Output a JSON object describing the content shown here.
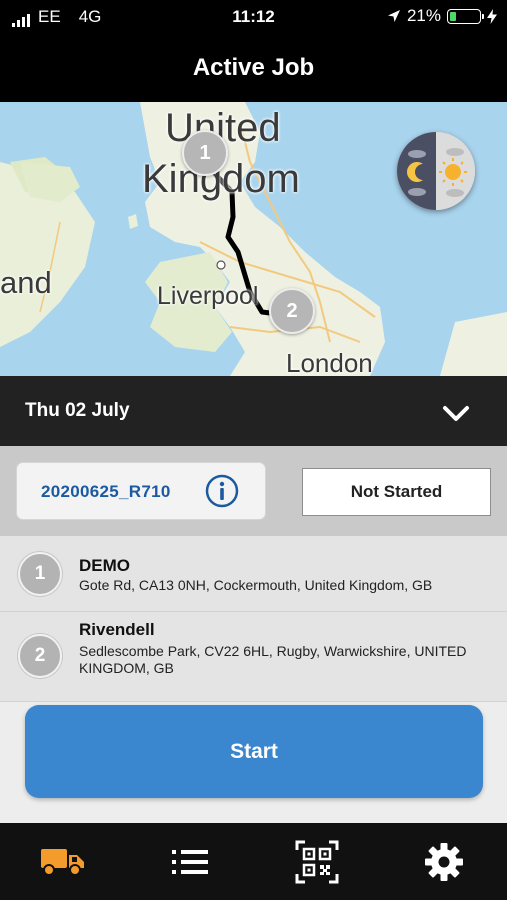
{
  "status_bar": {
    "carrier": "EE",
    "network": "4G",
    "time": "11:12",
    "battery_percent": "21%",
    "battery_level": 0.21
  },
  "header": {
    "title": "Active Job"
  },
  "map": {
    "labels": {
      "united": "United",
      "kingdom": "Kingdom",
      "and": "and",
      "liverpool": "Liverpool",
      "london": "London"
    },
    "pins": [
      "1",
      "2"
    ]
  },
  "date_bar": {
    "date": "Thu 02 July"
  },
  "job": {
    "id": "20200625_R710",
    "status": "Not Started"
  },
  "stops": [
    {
      "number": "1",
      "name": "DEMO",
      "address": "Gote Rd, CA13 0NH, Cockermouth, United Kingdom, GB"
    },
    {
      "number": "2",
      "name": "Rivendell",
      "address": "Sedlescombe Park, CV22 6HL, Rugby, Warwickshire, UNITED KINGDOM, GB"
    }
  ],
  "actions": {
    "start_label": "Start"
  },
  "colors": {
    "accent_blue": "#3a86cf",
    "job_id_text": "#1b5aa0",
    "tab_active": "#f39c2b",
    "battery_green": "#4cd964"
  },
  "tabs": [
    {
      "name": "jobs",
      "icon": "truck-icon",
      "active": true
    },
    {
      "name": "list",
      "icon": "list-icon",
      "active": false
    },
    {
      "name": "scan",
      "icon": "qr-code-icon",
      "active": false
    },
    {
      "name": "settings",
      "icon": "gear-icon",
      "active": false
    }
  ]
}
